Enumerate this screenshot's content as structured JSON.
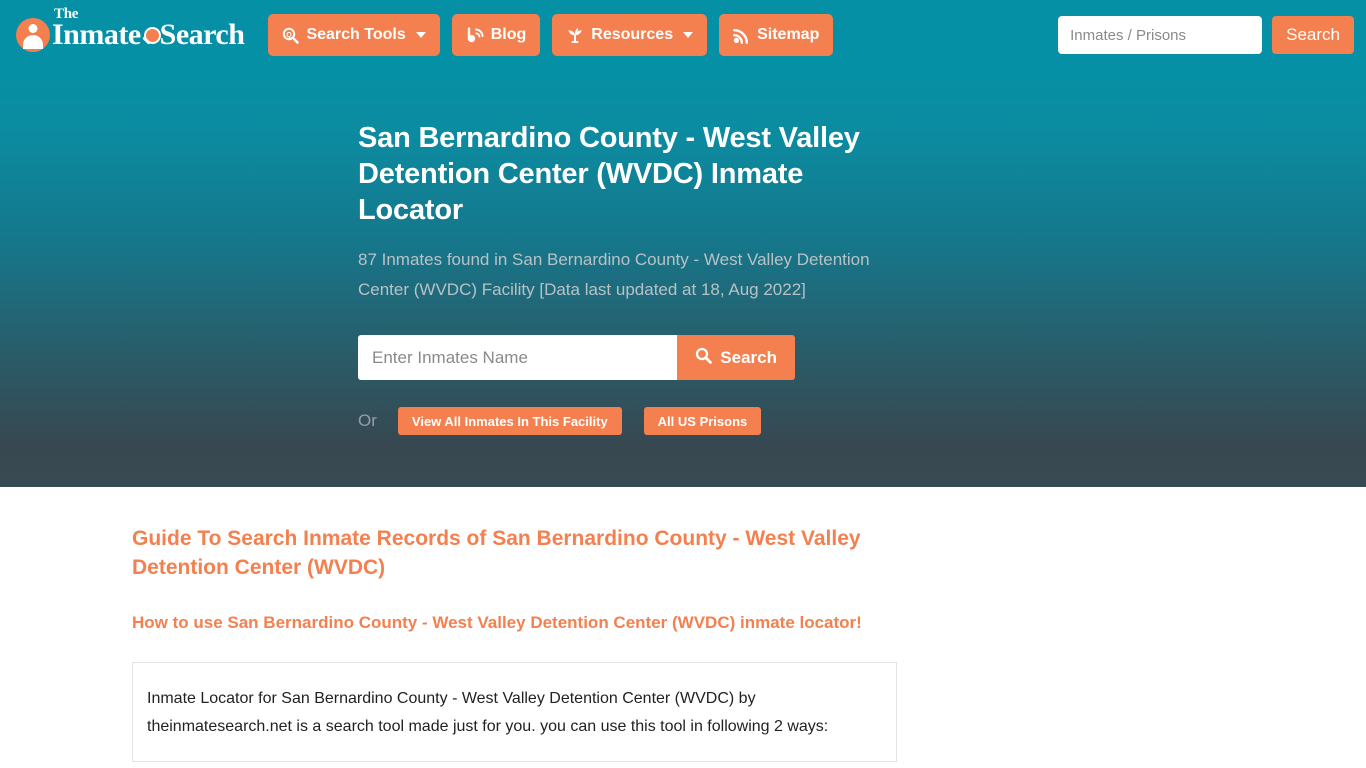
{
  "header": {
    "logo": {
      "the": "The",
      "word1": "Inmate",
      "word2": "Search",
      "icon": "person-in-circle-icon",
      "magnifier_icon": "magnifier-icon"
    },
    "nav_items": [
      {
        "label": "Search Tools",
        "icon": "search-tools-icon",
        "has_caret": true
      },
      {
        "label": "Blog",
        "icon": "blog-icon",
        "has_caret": false
      },
      {
        "label": "Resources",
        "icon": "seedling-icon",
        "has_caret": true
      },
      {
        "label": "Sitemap",
        "icon": "rss-icon",
        "has_caret": false
      }
    ],
    "search": {
      "placeholder": "Inmates / Prisons",
      "value": "",
      "button_label": "Search"
    }
  },
  "hero": {
    "title": "San Bernardino County - West Valley Detention Center (WVDC) Inmate Locator",
    "subtitle": "87 Inmates found in San Bernardino County - West Valley Detention Center (WVDC) Facility [Data last updated at 18, Aug 2022]",
    "search": {
      "placeholder": "Enter Inmates Name",
      "value": "",
      "button_label": "Search",
      "button_icon": "magnifier-icon"
    },
    "or_label": "Or",
    "view_all_label": "View All Inmates In This Facility",
    "all_prisons_label": "All US Prisons"
  },
  "main": {
    "guide_title": "Guide To Search Inmate Records of San Bernardino County - West Valley Detention Center (WVDC)",
    "howto_title": "How to use San Bernardino County - West Valley Detention Center (WVDC) inmate locator!",
    "body_text": "Inmate Locator for San Bernardino County - West Valley Detention Center (WVDC) by theinmatesearch.net is a search tool made just for you. you can use this tool in following 2 ways:"
  },
  "colors": {
    "teal": "#0690a5",
    "accent_orange": "#f4804f",
    "hero_bottom": "#3a4a52",
    "subtitle_gray": "#b8c2c6",
    "body_text": "#222222"
  }
}
